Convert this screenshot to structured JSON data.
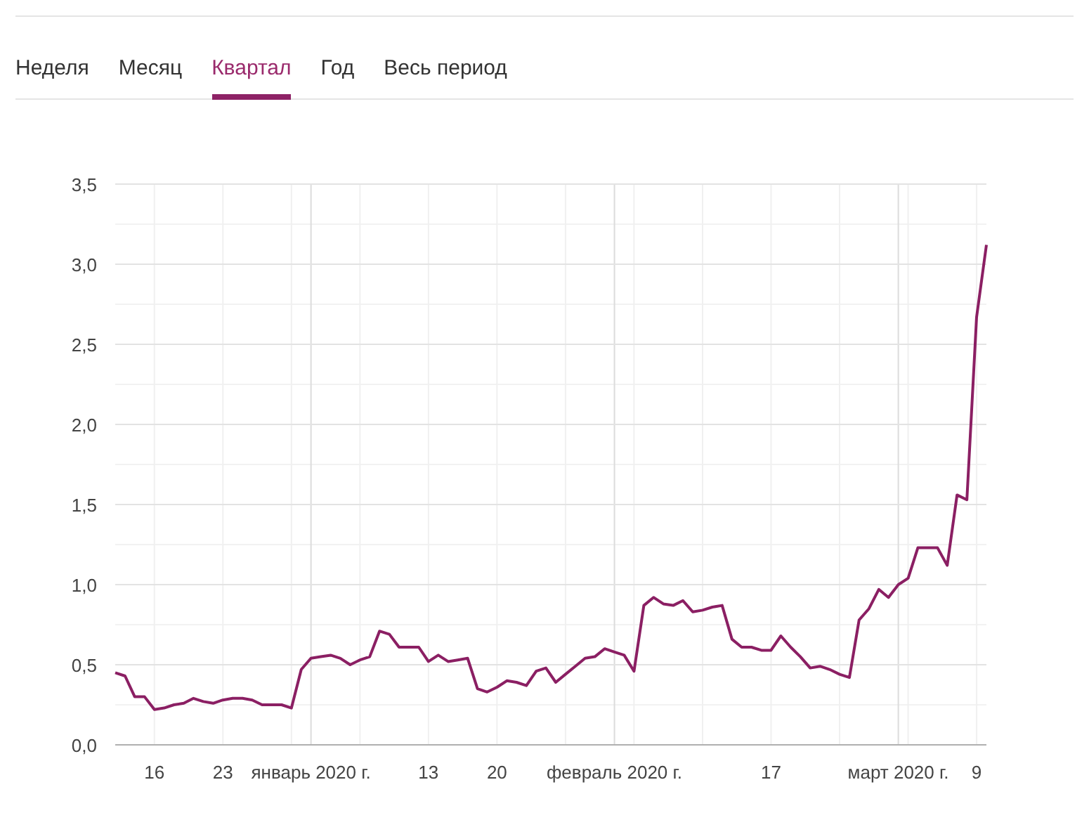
{
  "tabs": [
    {
      "label": "Неделя",
      "selected": false
    },
    {
      "label": "Месяц",
      "selected": false
    },
    {
      "label": "Квартал",
      "selected": true
    },
    {
      "label": "Год",
      "selected": false
    },
    {
      "label": "Весь период",
      "selected": false
    }
  ],
  "chart_data": {
    "type": "line",
    "grid": true,
    "categories": [
      null,
      null,
      null,
      null,
      "16",
      null,
      null,
      null,
      null,
      null,
      null,
      "23",
      null,
      null,
      null,
      null,
      null,
      null,
      null,
      null,
      "январь 2020 г.",
      null,
      null,
      null,
      null,
      null,
      null,
      null,
      null,
      null,
      null,
      null,
      "13",
      null,
      null,
      null,
      null,
      null,
      null,
      "20",
      null,
      null,
      null,
      null,
      null,
      null,
      null,
      null,
      null,
      null,
      null,
      "февраль 2020 г.",
      null,
      null,
      null,
      null,
      null,
      null,
      null,
      null,
      null,
      null,
      null,
      null,
      null,
      null,
      null,
      "17",
      null,
      null,
      null,
      null,
      null,
      null,
      null,
      null,
      null,
      null,
      null,
      null,
      "март 2020 г.",
      null,
      null,
      null,
      null,
      null,
      null,
      null,
      "9",
      null
    ],
    "ylim": [
      0,
      3.5
    ],
    "yticks": [
      {
        "value": 0,
        "label": "0,0"
      },
      {
        "value": 0.5,
        "label": "0,5"
      },
      {
        "value": 1,
        "label": "1,0"
      },
      {
        "value": 1.5,
        "label": "1,5"
      },
      {
        "value": 2,
        "label": "2,0"
      },
      {
        "value": 2.5,
        "label": "2,5"
      },
      {
        "value": 3,
        "label": "3,0"
      },
      {
        "value": 3.5,
        "label": "3,5"
      }
    ],
    "series": [
      {
        "color": "#8b1f63",
        "values": [
          0.45,
          0.43,
          0.3,
          0.3,
          0.22,
          0.23,
          0.25,
          0.26,
          0.29,
          0.27,
          0.26,
          0.28,
          0.29,
          0.29,
          0.28,
          0.25,
          0.25,
          0.25,
          0.23,
          0.47,
          0.54,
          0.55,
          0.56,
          0.54,
          0.5,
          0.53,
          0.55,
          0.71,
          0.69,
          0.61,
          0.61,
          0.61,
          0.52,
          0.56,
          0.52,
          0.53,
          0.54,
          0.35,
          0.33,
          0.36,
          0.4,
          0.39,
          0.37,
          0.46,
          0.48,
          0.39,
          0.44,
          0.49,
          0.54,
          0.55,
          0.6,
          0.58,
          0.56,
          0.46,
          0.87,
          0.92,
          0.88,
          0.87,
          0.9,
          0.83,
          0.84,
          0.86,
          0.87,
          0.66,
          0.61,
          0.61,
          0.59,
          0.59,
          0.68,
          0.61,
          0.55,
          0.48,
          0.49,
          0.47,
          0.44,
          0.42,
          0.78,
          0.85,
          0.97,
          0.92,
          1.0,
          1.04,
          1.23,
          1.23,
          1.23,
          1.12,
          1.56,
          1.53,
          2.67,
          3.12
        ]
      }
    ]
  }
}
